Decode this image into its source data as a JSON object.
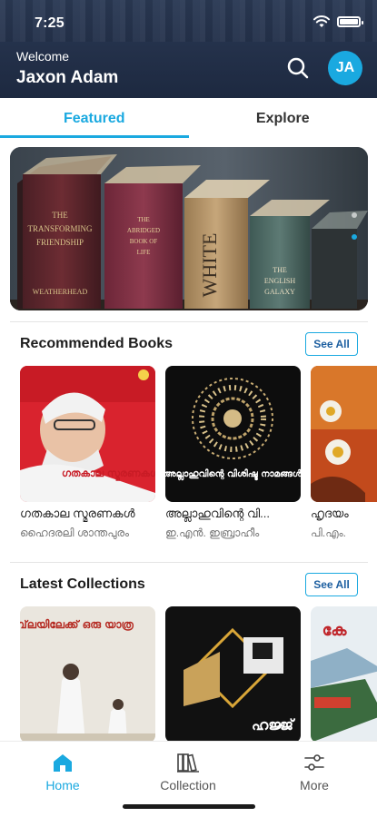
{
  "status_bar": {
    "time": "7:25"
  },
  "header": {
    "welcome": "Welcome",
    "user_name": "Jaxon Adam",
    "avatar_initials": "JA",
    "accent": "#1aa9e0",
    "background": "#233049"
  },
  "tabs": [
    {
      "label": "Featured",
      "active": true
    },
    {
      "label": "Explore",
      "active": false
    }
  ],
  "banner": {
    "book_spines": [
      "THE TRANSFORMING FRIENDSHIP",
      "WEATHERHEAD",
      "THE ABRIDGED BOOK",
      "WHITE",
      "THE ENGLISH GALAXY"
    ],
    "active_slide": 2,
    "slide_count": 2
  },
  "recommended": {
    "title": "Recommended Books",
    "see_all": "See All",
    "books": [
      {
        "title": "ഗതകാല സ്മരണകൾ",
        "author": "ഹൈദരലി ശാന്തപുരം",
        "cover_text": "ഗതകാല സ്മരണകൾ"
      },
      {
        "title": "അല്ലാഹുവിന്റെ വി...",
        "author": "ഇ.എൻ. ഇബ്രാഹീം",
        "cover_text": "അല്ലാഹുവിന്റെ വിശിഷ്ട നാമങ്ങൾ"
      },
      {
        "title": "ഹൃദയം",
        "author": "പി.എം.",
        "cover_text": ""
      }
    ]
  },
  "latest": {
    "title": "Latest Collections",
    "see_all": "See All",
    "books": [
      {
        "cover_text": "ഖിബ്‌ലയിലേക്ക് ഒരു യാത്ര"
      },
      {
        "cover_text": "ഹജ്ജ്"
      },
      {
        "cover_text": "കേ"
      }
    ]
  },
  "bottom_nav": [
    {
      "label": "Home",
      "icon": "home-icon",
      "active": true
    },
    {
      "label": "Collection",
      "icon": "books-icon",
      "active": false
    },
    {
      "label": "More",
      "icon": "sliders-icon",
      "active": false
    }
  ]
}
